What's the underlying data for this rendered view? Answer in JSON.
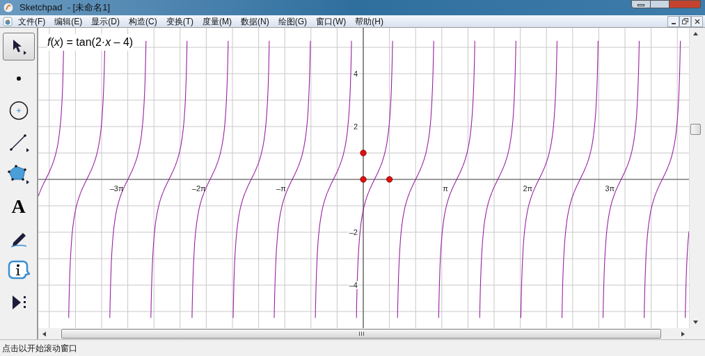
{
  "window": {
    "title": "Sketchpad  - [未命名1]"
  },
  "menu": [
    "文件(F)",
    "编辑(E)",
    "显示(D)",
    "构造(C)",
    "变换(T)",
    "度量(M)",
    "数据(N)",
    "绘图(G)",
    "窗口(W)",
    "帮助(H)"
  ],
  "tools": [
    {
      "kind": "arrow",
      "selected": true
    },
    {
      "kind": "point",
      "selected": false
    },
    {
      "kind": "compass",
      "selected": false
    },
    {
      "kind": "line",
      "selected": false
    },
    {
      "kind": "polygon",
      "selected": false
    },
    {
      "kind": "text",
      "label": "A",
      "selected": false
    },
    {
      "kind": "marker",
      "selected": false
    },
    {
      "kind": "info",
      "selected": false
    },
    {
      "kind": "custom",
      "selected": false
    }
  ],
  "graph": {
    "function_label": "*f*(*x*) = tan(2·*x* – 4)",
    "x_tick_labels": [
      "–3π",
      "–2π",
      "–π",
      "π",
      "2π",
      "3π"
    ],
    "y_tick_labels": [
      "4",
      "2",
      "–2",
      "–4"
    ]
  },
  "status_bar": "点击以开始滚动窗口"
}
